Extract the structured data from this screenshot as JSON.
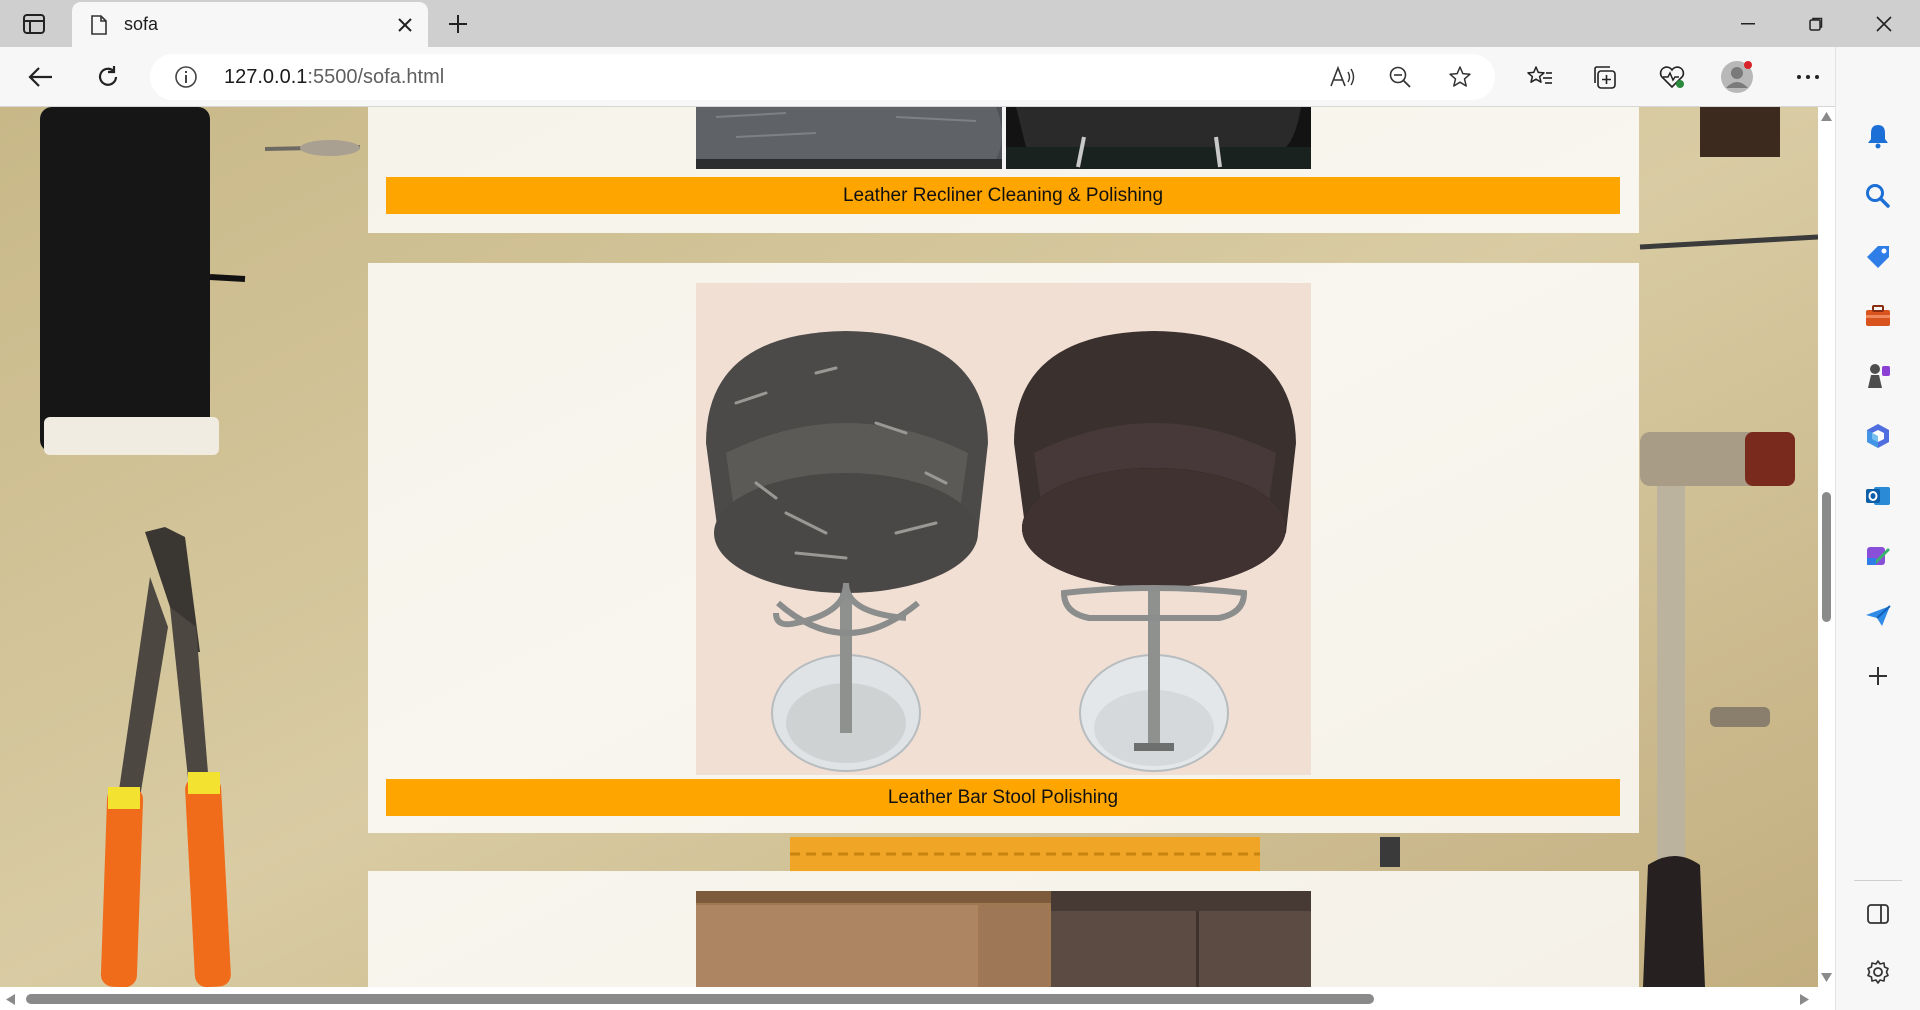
{
  "browser": {
    "tab_title": "sofa",
    "url_host": "127.0.0.1",
    "url_path": ":5500/sofa.html",
    "accent": "#ffa500"
  },
  "sections": [
    {
      "caption": "Leather Recliner Cleaning & Polishing"
    },
    {
      "caption": "Leather Bar Stool Polishing"
    },
    {
      "caption": ""
    }
  ],
  "icons": {
    "tab_actions": "tab-actions-icon",
    "favicon": "page-icon",
    "close": "close-icon",
    "new_tab": "plus-icon",
    "back": "back-arrow-icon",
    "reload": "reload-icon",
    "info": "info-icon",
    "read_aloud": "read-aloud-icon",
    "zoom_out": "zoom-out-icon",
    "favorite": "star-icon",
    "favorites": "favorites-list-icon",
    "collections": "collections-icon",
    "performance": "heart-pulse-icon",
    "profile": "profile-avatar",
    "more": "more-icon",
    "bing": "bing-icon",
    "sidebar": [
      "bell-icon",
      "search-icon",
      "tag-icon",
      "briefcase-icon",
      "games-icon",
      "office-icon",
      "outlook-icon",
      "designer-icon",
      "send-icon",
      "add-icon",
      "split-icon",
      "settings-icon"
    ]
  }
}
